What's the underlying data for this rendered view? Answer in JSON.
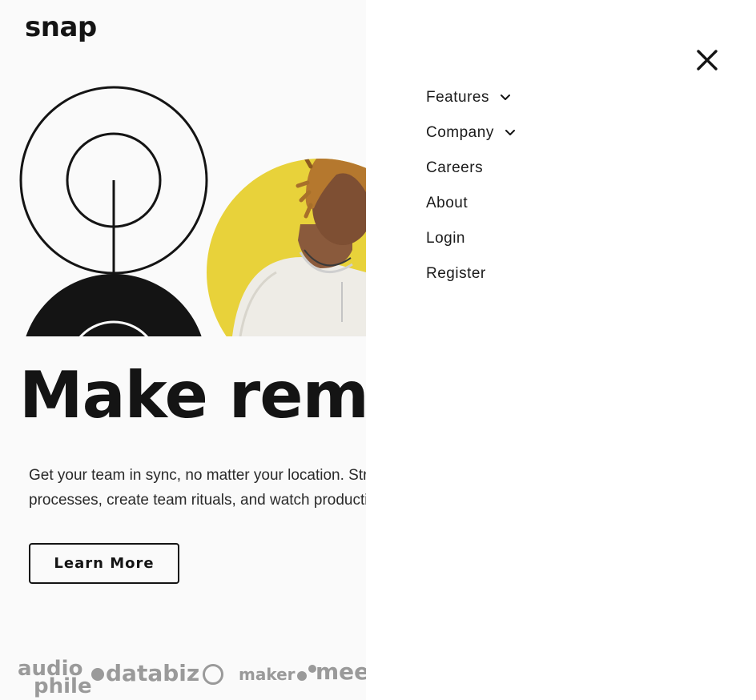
{
  "brand": {
    "logo": "snap"
  },
  "hero": {
    "headline": "Make remote work",
    "subtext": "Get your team in sync, no matter your location. Streamline processes, create team rituals, and watch productivity soar.",
    "cta_label": "Learn More"
  },
  "clients": {
    "audiophile_line1": "audio",
    "audiophile_line2": "phile",
    "databiz": "databiz",
    "maker": "maker",
    "meet": "meet"
  },
  "nav": {
    "items": [
      {
        "label": "Features",
        "icon": "chevron-down-icon"
      },
      {
        "label": "Company",
        "icon": "chevron-down-icon"
      },
      {
        "label": "Careers"
      },
      {
        "label": "About"
      },
      {
        "label": "Login"
      },
      {
        "label": "Register"
      }
    ]
  },
  "colors": {
    "accent_yellow": "#e8d23a",
    "ink": "#141414",
    "muted": "#9a9a9a",
    "drawer_bg": "#ffffff",
    "page_bg": "#fafafa"
  }
}
